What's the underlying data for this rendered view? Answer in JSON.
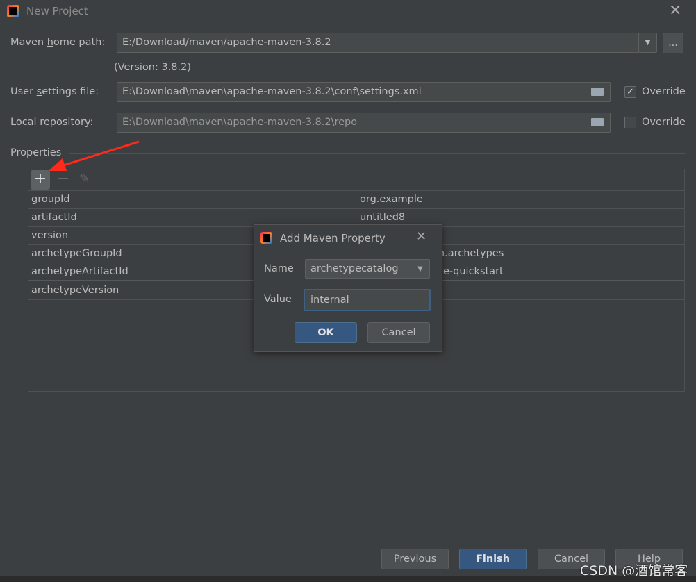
{
  "window": {
    "title": "New Project"
  },
  "form": {
    "maven_home_label": "Maven home path:",
    "maven_home_value": "E:/Download/maven/apache-maven-3.8.2",
    "browse_label": "...",
    "version_text": "(Version: 3.8.2)",
    "user_settings_label": "User settings file:",
    "user_settings_value": "E:\\Download\\maven\\apache-maven-3.8.2\\conf\\settings.xml",
    "user_settings_override": true,
    "local_repo_label": "Local repository:",
    "local_repo_value": "E:\\Download\\maven\\apache-maven-3.8.2\\repo",
    "local_repo_override": false,
    "override_label": "Override"
  },
  "properties": {
    "section_label": "Properties",
    "rows": [
      {
        "key": "groupId",
        "value": "org.example"
      },
      {
        "key": "artifactId",
        "value": "untitled8"
      },
      {
        "key": "version",
        "value": ""
      },
      {
        "key": "archetypeGroupId",
        "value": "en.archetypes"
      },
      {
        "key": "archetypeArtifactId",
        "value": "e-quickstart"
      },
      {
        "key": "archetypeVersion",
        "value": ""
      }
    ]
  },
  "dialog": {
    "title": "Add Maven Property",
    "name_label": "Name",
    "name_value": "archetypecatalog",
    "value_label": "Value",
    "value_value": "internal",
    "ok": "OK",
    "cancel": "Cancel"
  },
  "footer": {
    "previous": "Previous",
    "finish": "Finish",
    "cancel": "Cancel",
    "help": "Help"
  },
  "watermark": "CSDN @酒馆常客",
  "colors": {
    "background": "#3c3f41",
    "primary_button": "#365880",
    "annotation_arrow": "#ff2a1a"
  }
}
